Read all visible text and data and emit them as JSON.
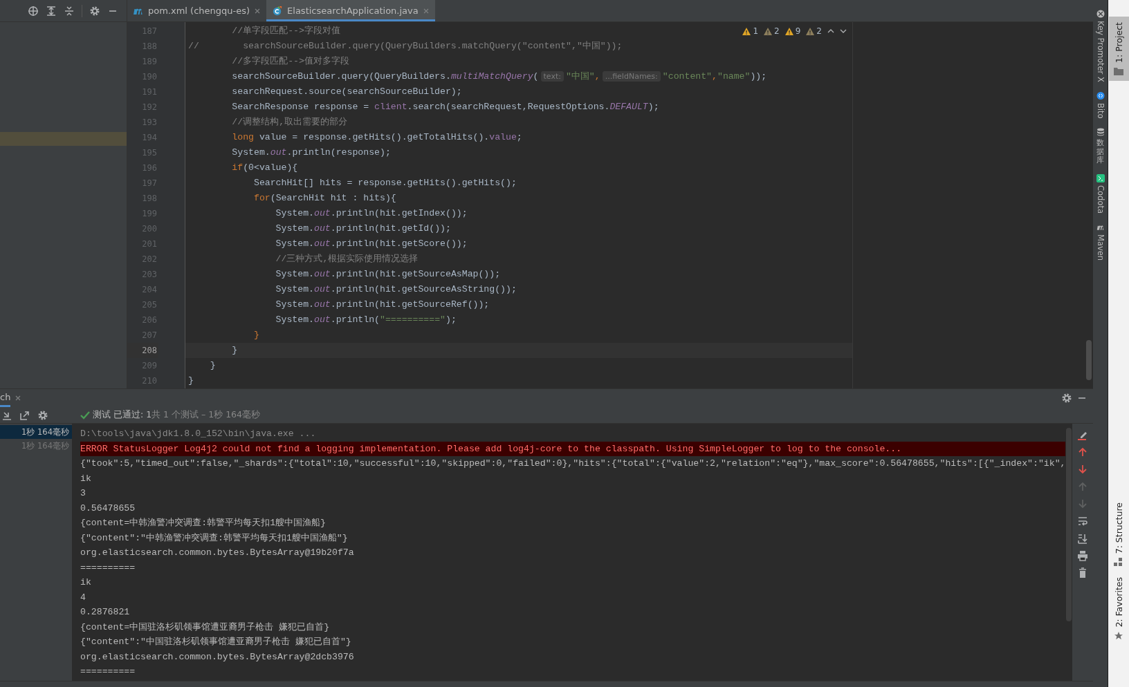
{
  "editor_tabs": [
    {
      "label": "pom.xml (chengqu-es)",
      "selected": false
    },
    {
      "label": "ElasticsearchApplication.java",
      "selected": true
    }
  ],
  "inspections": [
    {
      "count": "1",
      "color": "#e0a526"
    },
    {
      "count": "2",
      "color": "#8c7e5c"
    },
    {
      "count": "9",
      "color": "#e0a526"
    },
    {
      "count": "2",
      "color": "#8c7e5c"
    }
  ],
  "code_lines": [
    {
      "number": "187",
      "current": false,
      "parts": [
        {
          "kind": "comment",
          "text": "        //单字段匹配-->字段对值"
        }
      ]
    },
    {
      "number": "188",
      "current": false,
      "parts": [
        {
          "kind": "comment",
          "text": "//        searchSourceBuilder.query(QueryBuilders.matchQuery(\"content\",\"中国\"));"
        }
      ]
    },
    {
      "number": "189",
      "current": false,
      "parts": [
        {
          "kind": "comment",
          "text": "        //多字段匹配-->值对多字段"
        }
      ]
    },
    {
      "number": "190",
      "current": false,
      "parts": [
        {
          "kind": "text",
          "text": "        searchSourceBuilder.query(QueryBuilders."
        },
        {
          "kind": "static",
          "text": "multiMatchQuery"
        },
        {
          "kind": "text",
          "text": "("
        },
        {
          "kind": "hint",
          "text": "text:"
        },
        {
          "kind": "string",
          "text": "\"中国\""
        },
        {
          "kind": "keyword",
          "text": ","
        },
        {
          "kind": "hint",
          "text": "...fieldNames:"
        },
        {
          "kind": "string",
          "text": "\"content\""
        },
        {
          "kind": "keyword",
          "text": ","
        },
        {
          "kind": "string",
          "text": "\"name\""
        },
        {
          "kind": "text",
          "text": "));"
        }
      ]
    },
    {
      "number": "191",
      "current": false,
      "parts": [
        {
          "kind": "text",
          "text": "        searchRequest.source(searchSourceBuilder);"
        }
      ]
    },
    {
      "number": "192",
      "current": false,
      "parts": [
        {
          "kind": "text",
          "text": "        SearchResponse response = "
        },
        {
          "kind": "field",
          "text": "client"
        },
        {
          "kind": "text",
          "text": ".search(searchRequest,RequestOptions."
        },
        {
          "kind": "static",
          "text": "DEFAULT"
        },
        {
          "kind": "text",
          "text": ");"
        }
      ]
    },
    {
      "number": "193",
      "current": false,
      "parts": [
        {
          "kind": "comment",
          "text": "        //调整结构,取出需要的部分"
        }
      ]
    },
    {
      "number": "194",
      "current": false,
      "parts": [
        {
          "kind": "keyword",
          "text": "        long"
        },
        {
          "kind": "text",
          "text": " value = response.getHits().getTotalHits()."
        },
        {
          "kind": "field",
          "text": "value"
        },
        {
          "kind": "text",
          "text": ";"
        }
      ]
    },
    {
      "number": "195",
      "current": false,
      "parts": [
        {
          "kind": "text",
          "text": "        System."
        },
        {
          "kind": "static",
          "text": "out"
        },
        {
          "kind": "text",
          "text": ".println(response);"
        }
      ]
    },
    {
      "number": "196",
      "current": false,
      "parts": [
        {
          "kind": "keyword",
          "text": "        if"
        },
        {
          "kind": "text",
          "text": "(0<value){"
        }
      ]
    },
    {
      "number": "197",
      "current": false,
      "parts": [
        {
          "kind": "text",
          "text": "            SearchHit[] hits = response.getHits().getHits();"
        }
      ]
    },
    {
      "number": "198",
      "current": false,
      "parts": [
        {
          "kind": "keyword",
          "text": "            for"
        },
        {
          "kind": "text",
          "text": "(SearchHit hit : hits){"
        }
      ]
    },
    {
      "number": "199",
      "current": false,
      "parts": [
        {
          "kind": "text",
          "text": "                System."
        },
        {
          "kind": "static",
          "text": "out"
        },
        {
          "kind": "text",
          "text": ".println(hit.getIndex());"
        }
      ]
    },
    {
      "number": "200",
      "current": false,
      "parts": [
        {
          "kind": "text",
          "text": "                System."
        },
        {
          "kind": "static",
          "text": "out"
        },
        {
          "kind": "text",
          "text": ".println(hit.getId());"
        }
      ]
    },
    {
      "number": "201",
      "current": false,
      "parts": [
        {
          "kind": "text",
          "text": "                System."
        },
        {
          "kind": "static",
          "text": "out"
        },
        {
          "kind": "text",
          "text": ".println(hit.getScore());"
        }
      ]
    },
    {
      "number": "202",
      "current": false,
      "parts": [
        {
          "kind": "comment",
          "text": "                //三种方式,根据实际使用情况选择"
        }
      ]
    },
    {
      "number": "203",
      "current": false,
      "parts": [
        {
          "kind": "text",
          "text": "                System."
        },
        {
          "kind": "static",
          "text": "out"
        },
        {
          "kind": "text",
          "text": ".println(hit.getSourceAsMap());"
        }
      ]
    },
    {
      "number": "204",
      "current": false,
      "parts": [
        {
          "kind": "text",
          "text": "                System."
        },
        {
          "kind": "static",
          "text": "out"
        },
        {
          "kind": "text",
          "text": ".println(hit.getSourceAsString());"
        }
      ]
    },
    {
      "number": "205",
      "current": false,
      "parts": [
        {
          "kind": "text",
          "text": "                System."
        },
        {
          "kind": "static",
          "text": "out"
        },
        {
          "kind": "text",
          "text": ".println(hit.getSourceRef());"
        }
      ]
    },
    {
      "number": "206",
      "current": false,
      "parts": [
        {
          "kind": "text",
          "text": "                System."
        },
        {
          "kind": "static",
          "text": "out"
        },
        {
          "kind": "text",
          "text": ".println("
        },
        {
          "kind": "string",
          "text": "\"==========\""
        },
        {
          "kind": "text",
          "text": ");"
        }
      ]
    },
    {
      "number": "207",
      "current": false,
      "parts": [
        {
          "kind": "keyword",
          "text": "            }"
        }
      ]
    },
    {
      "number": "208",
      "current": true,
      "parts": [
        {
          "kind": "text",
          "text": "        }"
        }
      ]
    },
    {
      "number": "209",
      "current": false,
      "parts": [
        {
          "kind": "text",
          "text": "    }"
        }
      ]
    },
    {
      "number": "210",
      "current": false,
      "parts": [
        {
          "kind": "text",
          "text": "}"
        }
      ]
    }
  ],
  "right_tool_strip": [
    {
      "kind": "latin",
      "label": "Key Promoter X"
    },
    {
      "kind": "latin",
      "label": "Bito"
    },
    {
      "kind": "cjk",
      "label": "数据库"
    },
    {
      "kind": "latin",
      "label": "Codota"
    },
    {
      "kind": "latin",
      "label": "Maven"
    }
  ],
  "outer_tool_strip": [
    {
      "label": "1: Project",
      "selected": true
    },
    {
      "label": "7: Structure",
      "selected": false
    },
    {
      "label": "2: Favorites",
      "selected": false
    }
  ],
  "run_panel": {
    "tab": "ch",
    "status": "测试 已通过: 1",
    "summary": "共 1 个测试 – 1秒 164毫秒",
    "tests": [
      {
        "duration": "1秒 164毫秒",
        "selected": true
      },
      {
        "duration": "1秒 164毫秒",
        "selected": false
      }
    ],
    "console": [
      {
        "kind": "command",
        "text": "D:\\tools\\java\\jdk1.8.0_152\\bin\\java.exe ..."
      },
      {
        "kind": "error",
        "text": "ERROR StatusLogger Log4j2 could not find a logging implementation. Please add log4j-core to the classpath. Using SimpleLogger to log to the console..."
      },
      {
        "kind": "output",
        "text": "{\"took\":5,\"timed_out\":false,\"_shards\":{\"total\":10,\"successful\":10,\"skipped\":0,\"failed\":0},\"hits\":{\"total\":{\"value\":2,\"relation\":\"eq\"},\"max_score\":0.56478655,\"hits\":[{\"_index\":\"ik\","
      },
      {
        "kind": "output",
        "text": "ik"
      },
      {
        "kind": "output",
        "text": "3"
      },
      {
        "kind": "output",
        "text": "0.56478655"
      },
      {
        "kind": "output",
        "text": "{content=中韩渔警冲突调查:韩警平均每天扣1艘中国渔船}"
      },
      {
        "kind": "output",
        "text": "{\"content\":\"中韩渔警冲突调查:韩警平均每天扣1艘中国渔船\"}"
      },
      {
        "kind": "output",
        "text": "org.elasticsearch.common.bytes.BytesArray@19b20f7a"
      },
      {
        "kind": "output",
        "text": "=========="
      },
      {
        "kind": "output",
        "text": "ik"
      },
      {
        "kind": "output",
        "text": "4"
      },
      {
        "kind": "output",
        "text": "0.2876821"
      },
      {
        "kind": "output",
        "text": "{content=中国驻洛杉矶领事馆遭亚裔男子枪击 嫌犯已自首}"
      },
      {
        "kind": "output",
        "text": "{\"content\":\"中国驻洛杉矶领事馆遭亚裔男子枪击 嫌犯已自首\"}"
      },
      {
        "kind": "output",
        "text": "org.elasticsearch.common.bytes.BytesArray@2dcb3976"
      },
      {
        "kind": "output",
        "text": "=========="
      }
    ]
  }
}
